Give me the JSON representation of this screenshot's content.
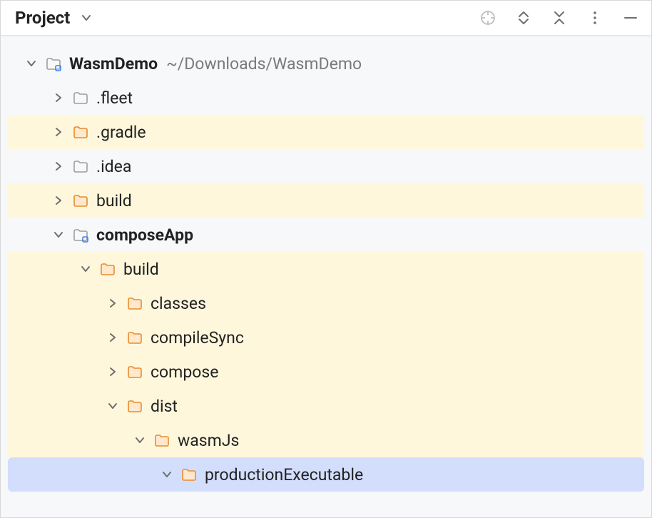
{
  "header": {
    "title": "Project"
  },
  "nodes": [
    {
      "id": "root",
      "indent": 0,
      "expanded": true,
      "iconType": "module",
      "label": "WasmDemo",
      "bold": true,
      "location": "~/Downloads/WasmDemo",
      "highlight": false
    },
    {
      "id": "fleet",
      "indent": 1,
      "expanded": false,
      "iconType": "folder-gray",
      "label": ".fleet",
      "highlight": false
    },
    {
      "id": "gradle",
      "indent": 1,
      "expanded": false,
      "iconType": "folder-orange",
      "label": ".gradle",
      "highlight": true
    },
    {
      "id": "idea",
      "indent": 1,
      "expanded": false,
      "iconType": "folder-gray",
      "label": ".idea",
      "highlight": false
    },
    {
      "id": "build1",
      "indent": 1,
      "expanded": false,
      "iconType": "folder-orange",
      "label": "build",
      "highlight": true
    },
    {
      "id": "composeApp",
      "indent": 1,
      "expanded": true,
      "iconType": "module",
      "label": "composeApp",
      "bold": true,
      "highlight": false
    },
    {
      "id": "build2",
      "indent": 2,
      "expanded": true,
      "iconType": "folder-orange",
      "label": "build",
      "highlight": true
    },
    {
      "id": "classes",
      "indent": 3,
      "expanded": false,
      "iconType": "folder-orange",
      "label": "classes",
      "highlight": true
    },
    {
      "id": "compileSync",
      "indent": 3,
      "expanded": false,
      "iconType": "folder-orange",
      "label": "compileSync",
      "highlight": true
    },
    {
      "id": "compose",
      "indent": 3,
      "expanded": false,
      "iconType": "folder-orange",
      "label": "compose",
      "highlight": true
    },
    {
      "id": "dist",
      "indent": 3,
      "expanded": true,
      "iconType": "folder-orange",
      "label": "dist",
      "highlight": true
    },
    {
      "id": "wasmJs",
      "indent": 4,
      "expanded": true,
      "iconType": "folder-orange",
      "label": "wasmJs",
      "highlight": true
    },
    {
      "id": "productionExecutable",
      "indent": 5,
      "expanded": true,
      "iconType": "folder-orange",
      "label": "productionExecutable",
      "highlight": false,
      "selected": true
    }
  ],
  "icons": {
    "chevronRight": "›",
    "chevronDown": "⌄"
  },
  "colors": {
    "highlight": "#fef7dc",
    "selected": "#d3defd",
    "folderOrange": "#e88c30",
    "folderGray": "#9e9e9e",
    "moduleBlue": "#3b82f6"
  }
}
